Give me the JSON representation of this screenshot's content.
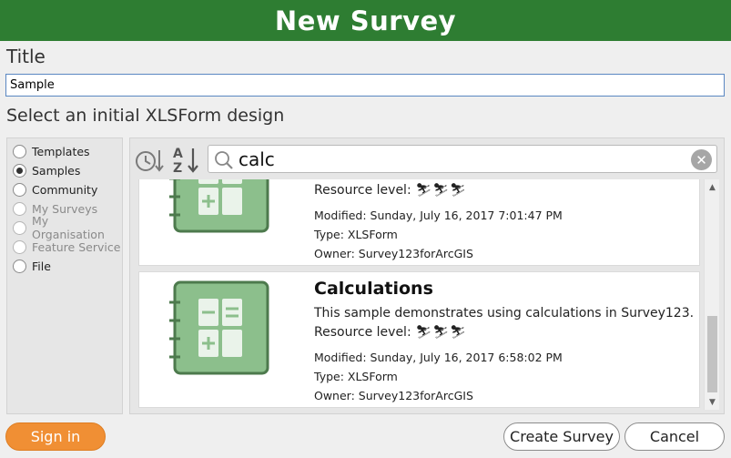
{
  "header": {
    "title": "New Survey"
  },
  "title_field": {
    "label": "Title",
    "value": "Sample"
  },
  "design": {
    "label": "Select an initial XLSForm design"
  },
  "sources": {
    "items": [
      {
        "label": "Templates",
        "checked": false,
        "enabled": true
      },
      {
        "label": "Samples",
        "checked": true,
        "enabled": true
      },
      {
        "label": "Community",
        "checked": false,
        "enabled": true
      },
      {
        "label": "My Surveys",
        "checked": false,
        "enabled": false
      },
      {
        "label": "My Organisation",
        "checked": false,
        "enabled": false
      },
      {
        "label": "Feature Service",
        "checked": false,
        "enabled": false
      },
      {
        "label": "File",
        "checked": false,
        "enabled": true
      }
    ]
  },
  "search": {
    "value": "calc",
    "sort_by_date_icon": "clock-sort-icon",
    "sort_az_icon": "sort-az-icon",
    "clear_icon": "clear-search-icon"
  },
  "results": [
    {
      "name": "",
      "description": "",
      "resource_level_label": "Resource level:",
      "resource_level_icons": "⛷⛷⛷",
      "modified": "Modified: Sunday, July 16, 2017 7:01:47 PM",
      "type": "Type: XLSForm",
      "owner": "Owner: Survey123forArcGIS"
    },
    {
      "name": "Calculations",
      "description": "This sample demonstrates using calculations in Survey123.",
      "resource_level_label": "Resource level:",
      "resource_level_icons": "⛷⛷⛷",
      "modified": "Modified: Sunday, July 16, 2017 6:58:02 PM",
      "type": "Type: XLSForm",
      "owner": "Owner: Survey123forArcGIS"
    }
  ],
  "footer": {
    "sign_in": "Sign in",
    "create": "Create Survey",
    "cancel": "Cancel"
  },
  "colors": {
    "header": "#2e7d32",
    "sign_in": "#f08f34",
    "thumbnail_green": "#8cbf8c",
    "thumbnail_dark": "#4d7a4d"
  }
}
